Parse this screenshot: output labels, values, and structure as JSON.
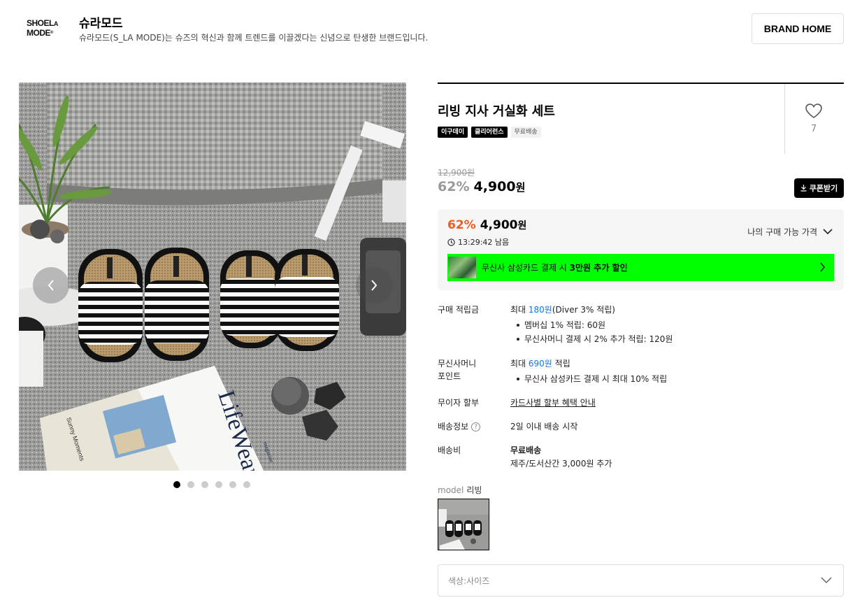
{
  "brand": {
    "logo_text": "SHOELA MODE",
    "name": "슈라모드",
    "description": "슈라모드(S_LA MODE)는 슈즈의 혁신과 함께 트렌드를 이끌겠다는 신념으로 탄생한 브랜드입니다.",
    "home_button": "BRAND HOME"
  },
  "gallery": {
    "dots_count": 6,
    "active_index": 0,
    "magazine_title": "LifeWear",
    "magazine_sub": "magazine",
    "magazine_side": "Sunny Moments"
  },
  "product": {
    "title": "리빙 지사 거실화 세트",
    "tags": [
      "이구데이",
      "클리어런스",
      "무료배송"
    ],
    "likes": "7",
    "original_price": "12,900원",
    "discount": "62%",
    "price": "4,900",
    "price_unit": "원",
    "coupon_button": "쿠폰받기"
  },
  "price_box": {
    "discount": "62%",
    "price": "4,900",
    "price_unit": "원",
    "timer": "13:29:42 남음",
    "my_price_label": "나의 구매 가능 가격",
    "card_text_pre": "무신사 삼성카드 결제 시 ",
    "card_text_bold": "3만원 추가 할인"
  },
  "info": {
    "points_label": "구매 적립금",
    "points_pre": "최대 ",
    "points_amount": "180원",
    "points_post": "(Diver 3% 적립)",
    "points_bullet_1": "멤버십 1% 적립: 60원",
    "points_bullet_2": "무신사머니 결제 시 2% 추가 적립: 120원",
    "money_label_1": "무신사머니",
    "money_label_2": "포인트",
    "money_pre": "최대 ",
    "money_amount": "690원",
    "money_post": " 적립",
    "money_bullet": "무신사 삼성카드 결제 시 최대 10% 적립",
    "installment_label": "무이자 할부",
    "installment_link": "카드사별 할부 혜택 안내",
    "shipping_info_label": "배송정보",
    "shipping_info_value": "2일 이내 배송 시작",
    "shipping_fee_label": "배송비",
    "shipping_fee_value": "무료배송",
    "shipping_fee_extra": "제주/도서산간 3,000원 추가"
  },
  "model": {
    "label": "model",
    "value": "리빙"
  },
  "option_select": {
    "placeholder": "색상:사이즈"
  },
  "colors": {
    "accent_orange": "#f25a1f",
    "link_blue": "#0078ff",
    "banner_green": "#00ff00"
  }
}
